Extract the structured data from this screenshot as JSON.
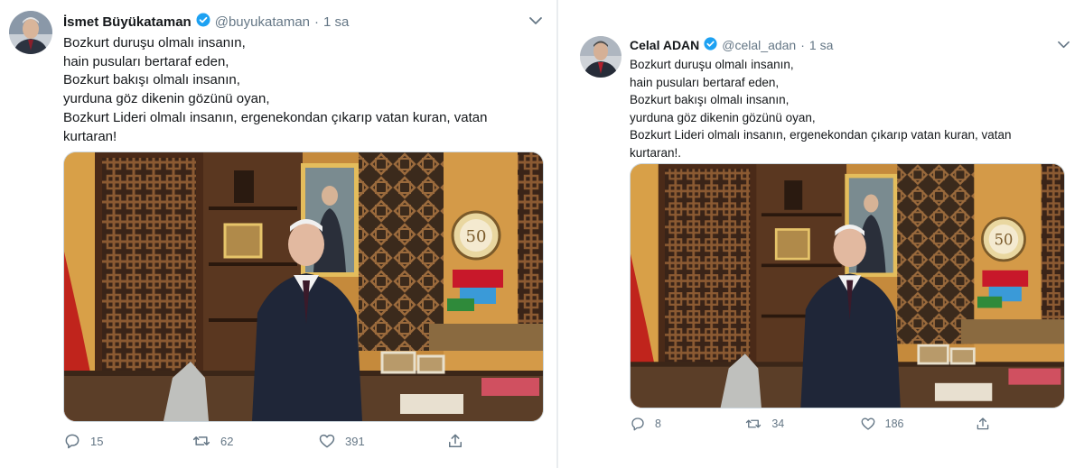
{
  "left_tweet": {
    "name": "İsmet Büyükataman",
    "handle": "@buyukataman",
    "separator": "·",
    "time": "1 sa",
    "lines": [
      "Bozkurt duruşu olmalı insanın,",
      "hain pusuları bertaraf eden,",
      "Bozkurt bakışı olmalı insanın,",
      "yurduna göz dikenin gözünü oyan,",
      "Bozkurt Lideri olmalı insanın, ergenekondan çıkarıp vatan kuran, vatan",
      "kurtaran!"
    ],
    "actions": {
      "reply_count": "15",
      "retweet_count": "62",
      "like_count": "391"
    }
  },
  "right_tweet": {
    "name": "Celal ADAN",
    "handle": "@celal_adan",
    "separator": "·",
    "time": "1 sa",
    "lines": [
      "Bozkurt duruşu olmalı insanın,",
      "hain pusuları bertaraf eden,",
      "Bozkurt bakışı olmalı insanın,",
      "yurduna göz dikenin gözünü oyan,",
      "Bozkurt Lideri olmalı insanın, ergenekondan çıkarıp vatan kuran, vatan",
      "kurtaran!."
    ],
    "actions": {
      "reply_count": "8",
      "retweet_count": "34",
      "like_count": "186"
    }
  },
  "icons": {
    "verified": "verified-badge-icon",
    "chevron": "chevron-down-icon",
    "reply": "reply-icon",
    "retweet": "retweet-icon",
    "like": "heart-icon",
    "share": "share-icon"
  },
  "colors": {
    "verified_blue": "#1da1f2",
    "icon_gray": "#657786",
    "text": "#14171a"
  }
}
